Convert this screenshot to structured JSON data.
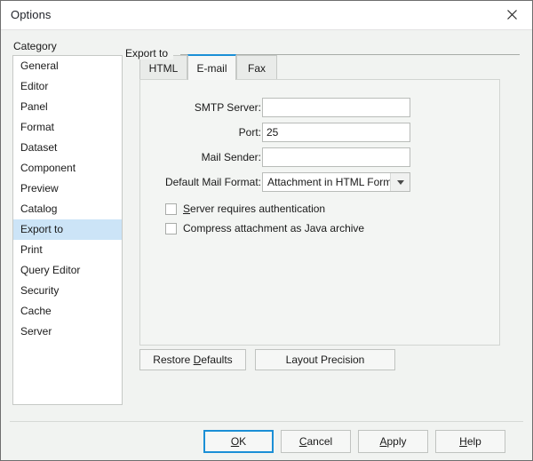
{
  "window": {
    "title": "Options",
    "close_icon": "close-icon"
  },
  "category": {
    "label": "Category",
    "items": [
      {
        "label": "General",
        "selected": false
      },
      {
        "label": "Editor",
        "selected": false
      },
      {
        "label": "Panel",
        "selected": false
      },
      {
        "label": "Format",
        "selected": false
      },
      {
        "label": "Dataset",
        "selected": false
      },
      {
        "label": "Component",
        "selected": false
      },
      {
        "label": "Preview",
        "selected": false
      },
      {
        "label": "Catalog",
        "selected": false
      },
      {
        "label": "Export to",
        "selected": true
      },
      {
        "label": "Print",
        "selected": false
      },
      {
        "label": "Query Editor",
        "selected": false
      },
      {
        "label": "Security",
        "selected": false
      },
      {
        "label": "Cache",
        "selected": false
      },
      {
        "label": "Server",
        "selected": false
      }
    ]
  },
  "group": {
    "title": "Export to"
  },
  "tabs": [
    {
      "label": "HTML",
      "active": false
    },
    {
      "label": "E-mail",
      "active": true
    },
    {
      "label": "Fax",
      "active": false
    }
  ],
  "form": {
    "fields": [
      {
        "label": "SMTP Server:",
        "value": "",
        "type": "text"
      },
      {
        "label": "Port:",
        "value": "25",
        "type": "text"
      },
      {
        "label": "Mail Sender:",
        "value": "",
        "type": "text"
      },
      {
        "label": "Default Mail Format:",
        "value": "Attachment in HTML Format",
        "type": "combo"
      }
    ],
    "checkboxes": [
      {
        "label": "Server requires authentication",
        "mnemonic": "S",
        "checked": false
      },
      {
        "label": "Compress attachment as Java archive",
        "mnemonic": "",
        "checked": false
      }
    ]
  },
  "panel_buttons": [
    {
      "label": "Restore Defaults",
      "mnemonic": "D"
    },
    {
      "label": "Layout Precision",
      "mnemonic": ""
    }
  ],
  "footer_buttons": [
    {
      "label": "OK",
      "mnemonic": "O",
      "default": true
    },
    {
      "label": "Cancel",
      "mnemonic": "C",
      "default": false
    },
    {
      "label": "Apply",
      "mnemonic": "A",
      "default": false
    },
    {
      "label": "Help",
      "mnemonic": "H",
      "default": false
    }
  ],
  "colors": {
    "accent": "#1b8fd6",
    "selection": "#cce4f7",
    "window_bg": "#f1f3f1"
  }
}
